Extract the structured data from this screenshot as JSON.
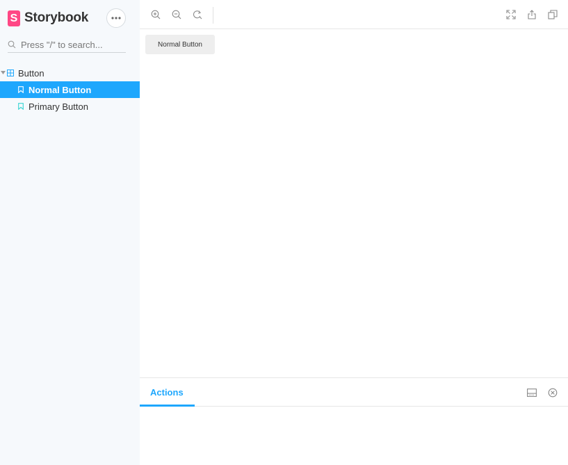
{
  "sidebar": {
    "brand": {
      "mark": "S",
      "name": "Storybook"
    },
    "menu_icon": "ellipsis-icon",
    "search": {
      "placeholder": "Press \"/\" to search...",
      "value": ""
    },
    "group": {
      "label": "Button",
      "icon": "component-icon",
      "expanded": true
    },
    "items": [
      {
        "label": "Normal Button",
        "selected": true,
        "icon": "bookmark-icon"
      },
      {
        "label": "Primary Button",
        "selected": false,
        "icon": "bookmark-icon"
      }
    ]
  },
  "toolbar": {
    "left": [
      "zoom-in-icon",
      "zoom-out-icon",
      "zoom-reset-icon"
    ],
    "right": [
      "fullscreen-icon",
      "share-icon",
      "copy-icon"
    ]
  },
  "preview": {
    "button_label": "Normal Button"
  },
  "panel": {
    "tabs": [
      {
        "label": "Actions",
        "active": true
      }
    ],
    "controls": [
      "panel-orientation-icon",
      "close-panel-icon"
    ]
  },
  "colors": {
    "accent": "#1ea7fd",
    "brand": "#ff4785",
    "sidebar_bg": "#f6f9fc",
    "bookmark": "#37d5d3"
  }
}
